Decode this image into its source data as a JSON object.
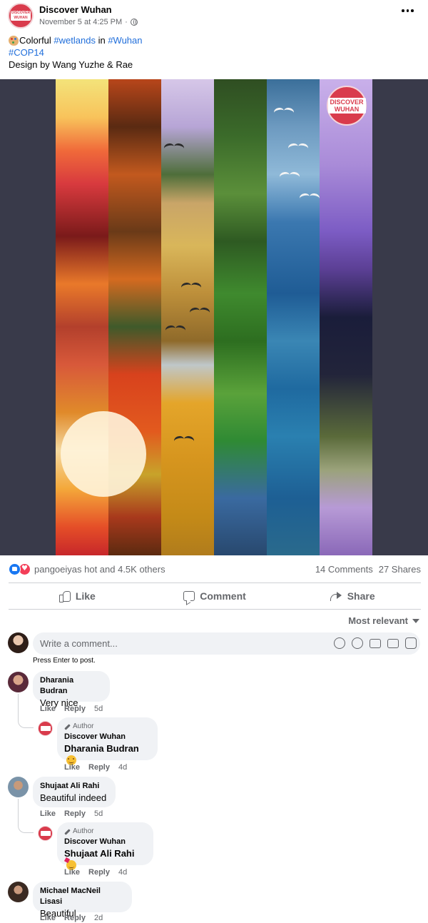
{
  "post": {
    "page_name": "Discover Wuhan",
    "timestamp": "November 5 at 4:25 PM",
    "separator": "·",
    "avatar_text": "DISCOVER WUHAN",
    "caption": {
      "line1_prefix": "Colorful ",
      "hashtag_wetlands": "#wetlands",
      "line1_mid": " in ",
      "hashtag_wuhan": "#Wuhan",
      "hashtag_cop14": "#COP14",
      "line3": "Design by Wang Yuzhe & Rae"
    },
    "image_watermark": "DISCOVER WUHAN"
  },
  "reactions": {
    "summary": "pangoeiyas hot and 4.5K others",
    "comments": "14 Comments",
    "shares": "27 Shares"
  },
  "actions": {
    "like": "Like",
    "comment": "Comment",
    "share": "Share"
  },
  "sort": {
    "label": "Most relevant"
  },
  "composer": {
    "placeholder": "Write a comment...",
    "hint": "Press Enter to post."
  },
  "comments": [
    {
      "author": "Dharania Budran",
      "text": "Very nice",
      "like": "Like",
      "reply": "Reply",
      "time": "5d",
      "reply_item": {
        "badge": "Author",
        "author": "Discover Wuhan",
        "text": "Dharania Budran",
        "like": "Like",
        "reply": "Reply",
        "time": "4d"
      }
    },
    {
      "author": "Shujaat Ali Rahi",
      "text": "Beautiful indeed",
      "like": "Like",
      "reply": "Reply",
      "time": "5d",
      "reply_item": {
        "badge": "Author",
        "author": "Discover Wuhan",
        "text": "Shujaat Ali Rahi",
        "like": "Like",
        "reply": "Reply",
        "time": "4d"
      }
    },
    {
      "author": "Michael MacNeil Lisasi",
      "text": "Beautiful",
      "like": "Like",
      "reply": "Reply",
      "time": "2d"
    }
  ]
}
